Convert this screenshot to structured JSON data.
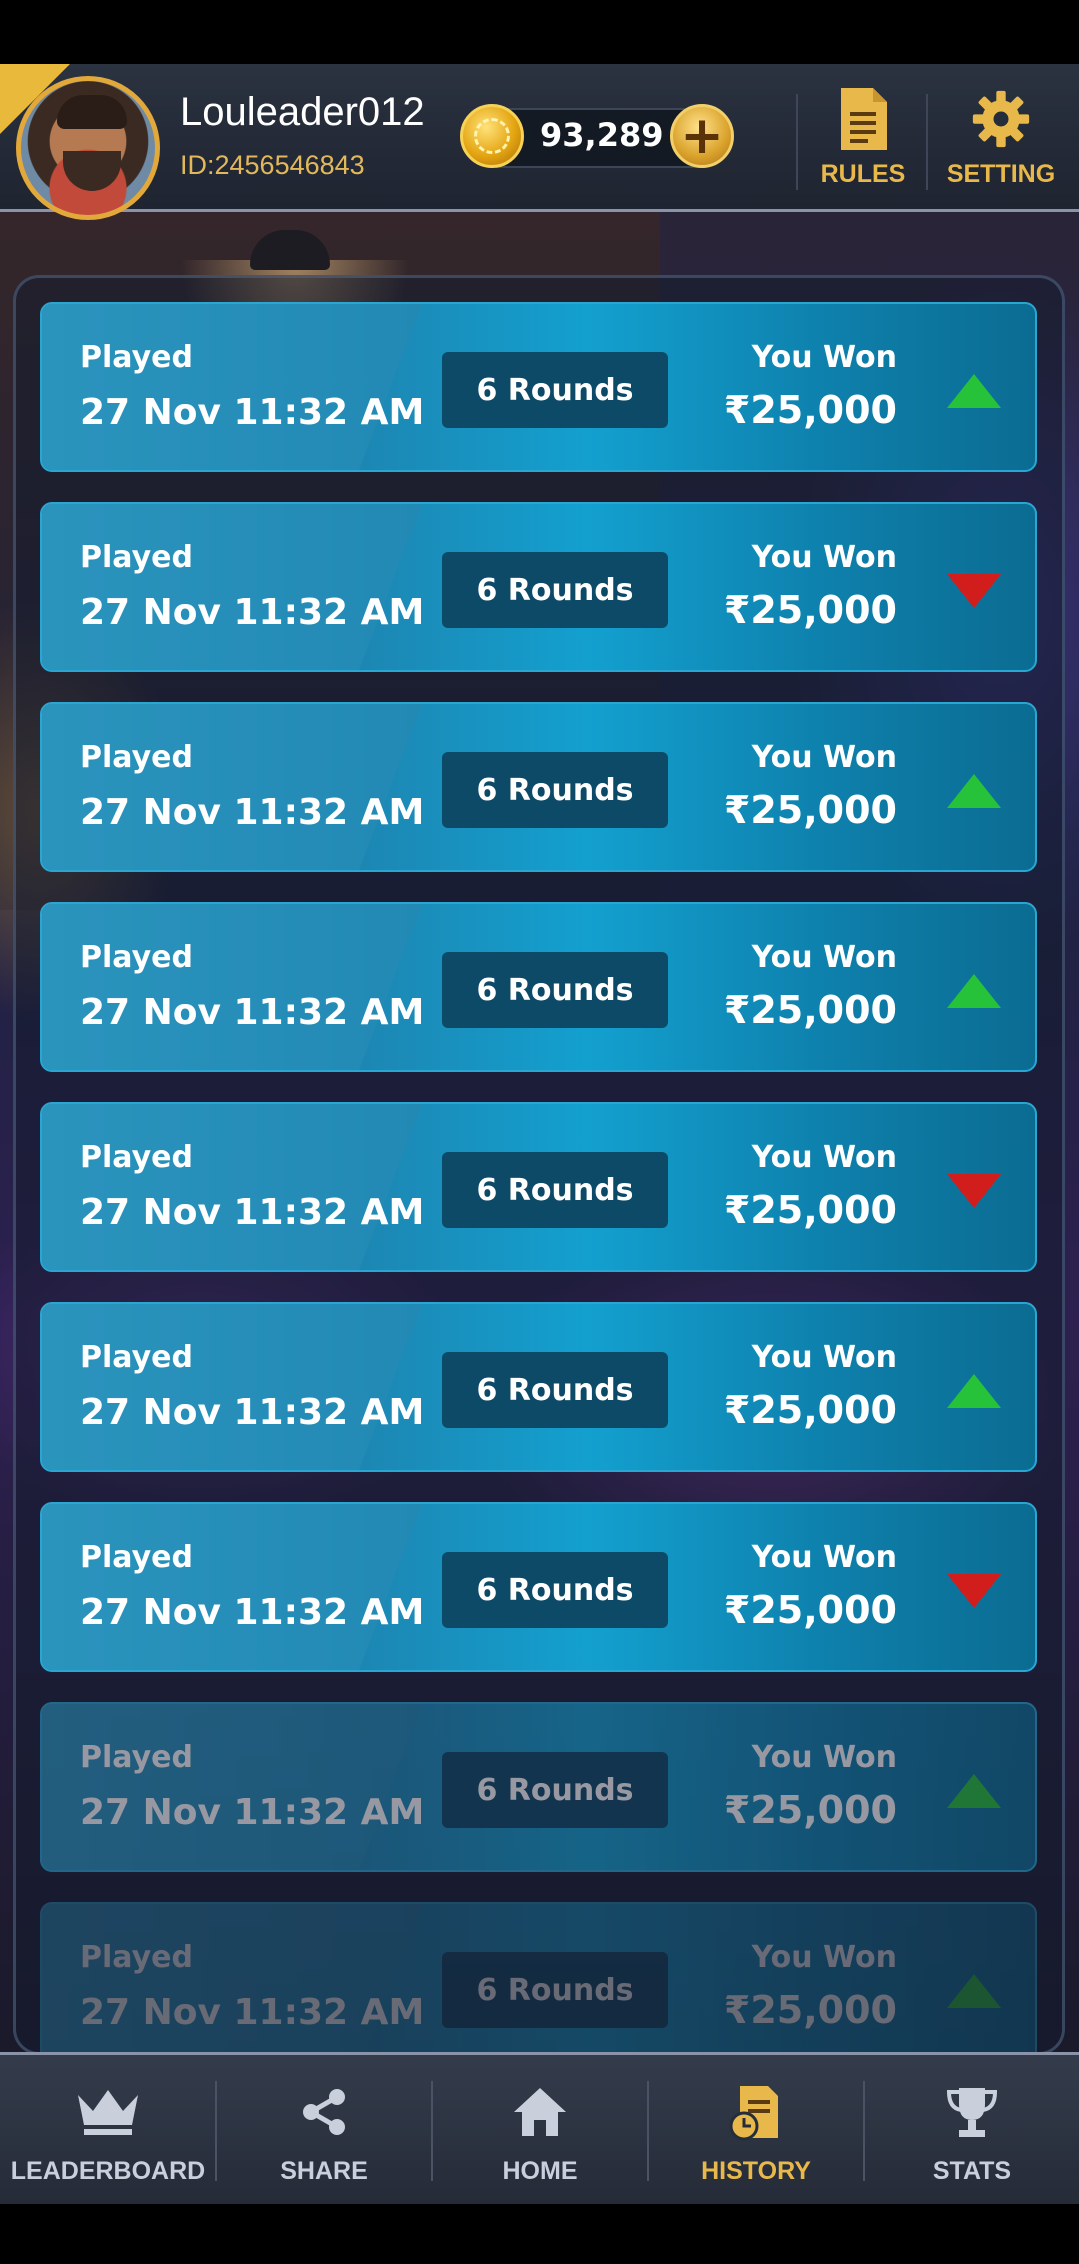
{
  "header": {
    "username": "Louleader012",
    "user_id": "ID:2456546843",
    "coins": "93,289",
    "add_symbol": "+",
    "rules_label": "RULES",
    "setting_label": "SETTING"
  },
  "history": {
    "rows": [
      {
        "played_label": "Played",
        "date": "27 Nov 11:32 AM",
        "rounds": "6 Rounds",
        "result_label": "You Won",
        "amount": "₹25,000",
        "trend": "up"
      },
      {
        "played_label": "Played",
        "date": "27 Nov 11:32 AM",
        "rounds": "6 Rounds",
        "result_label": "You Won",
        "amount": "₹25,000",
        "trend": "down"
      },
      {
        "played_label": "Played",
        "date": "27 Nov 11:32 AM",
        "rounds": "6 Rounds",
        "result_label": "You Won",
        "amount": "₹25,000",
        "trend": "up"
      },
      {
        "played_label": "Played",
        "date": "27 Nov 11:32 AM",
        "rounds": "6 Rounds",
        "result_label": "You Won",
        "amount": "₹25,000",
        "trend": "up"
      },
      {
        "played_label": "Played",
        "date": "27 Nov 11:32 AM",
        "rounds": "6 Rounds",
        "result_label": "You Won",
        "amount": "₹25,000",
        "trend": "down"
      },
      {
        "played_label": "Played",
        "date": "27 Nov 11:32 AM",
        "rounds": "6 Rounds",
        "result_label": "You Won",
        "amount": "₹25,000",
        "trend": "up"
      },
      {
        "played_label": "Played",
        "date": "27 Nov 11:32 AM",
        "rounds": "6 Rounds",
        "result_label": "You Won",
        "amount": "₹25,000",
        "trend": "down"
      },
      {
        "played_label": "Played",
        "date": "27 Nov 11:32 AM",
        "rounds": "6 Rounds",
        "result_label": "You Won",
        "amount": "₹25,000",
        "trend": "up"
      },
      {
        "played_label": "Played",
        "date": "27 Nov 11:32 AM",
        "rounds": "6 Rounds",
        "result_label": "You Won",
        "amount": "₹25,000",
        "trend": "up"
      }
    ]
  },
  "nav": {
    "items": [
      {
        "label": "LEADERBOARD",
        "icon": "crown-icon"
      },
      {
        "label": "SHARE",
        "icon": "share-icon"
      },
      {
        "label": "HOME",
        "icon": "home-icon"
      },
      {
        "label": "HISTORY",
        "icon": "history-icon",
        "active": true
      },
      {
        "label": "STATS",
        "icon": "trophy-icon"
      }
    ]
  },
  "colors": {
    "accent_gold": "#e8b94a",
    "trend_up": "#26c23a",
    "trend_down": "#d21d1d",
    "row_blue": "#13a0cf"
  }
}
